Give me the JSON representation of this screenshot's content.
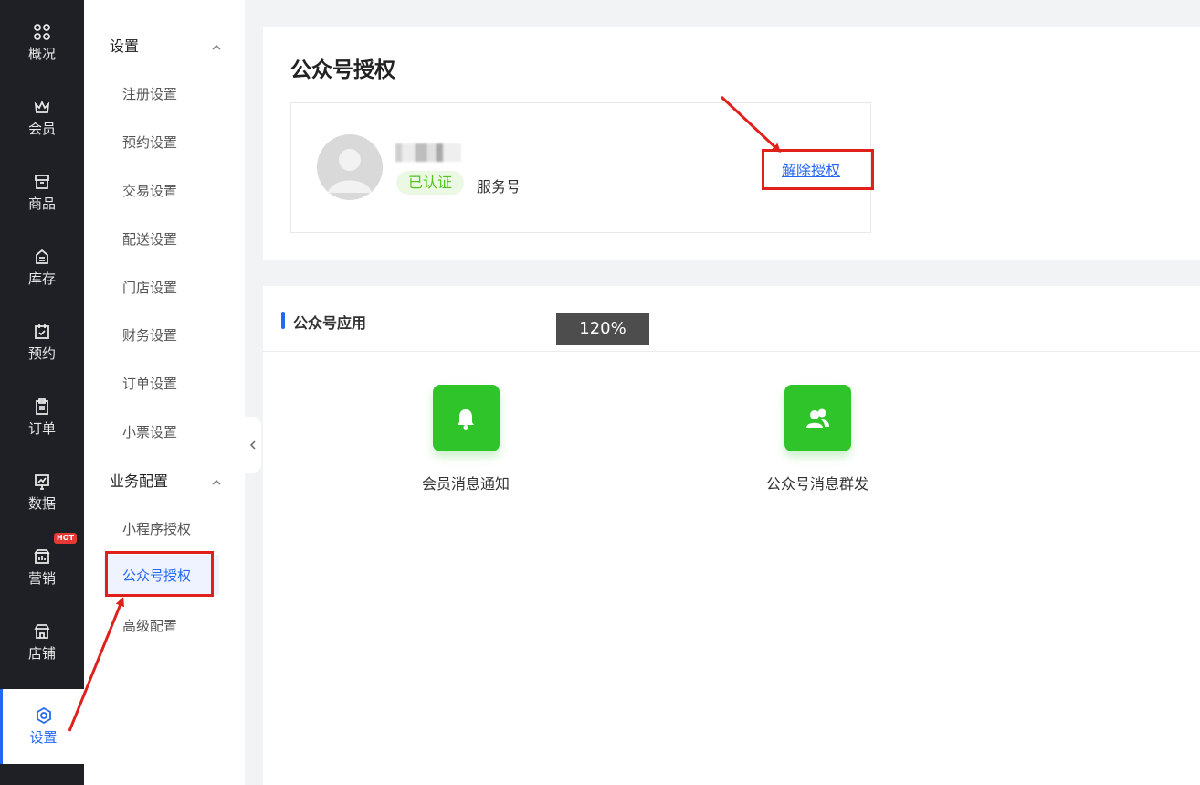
{
  "rail": {
    "items": [
      {
        "label": "概况",
        "icon": "dashboard-icon"
      },
      {
        "label": "会员",
        "icon": "crown-icon"
      },
      {
        "label": "商品",
        "icon": "shop-box-icon"
      },
      {
        "label": "库存",
        "icon": "inventory-icon"
      },
      {
        "label": "预约",
        "icon": "calendar-check-icon"
      },
      {
        "label": "订单",
        "icon": "clipboard-icon"
      },
      {
        "label": "数据",
        "icon": "chart-icon"
      },
      {
        "label": "营销",
        "icon": "marketing-icon",
        "badge": "HOT"
      },
      {
        "label": "店铺",
        "icon": "store-icon"
      },
      {
        "label": "设置",
        "icon": "settings-icon",
        "active": true
      }
    ]
  },
  "submenu": {
    "groups": [
      {
        "title": "设置",
        "items": [
          "注册设置",
          "预约设置",
          "交易设置",
          "配送设置",
          "门店设置",
          "财务设置",
          "订单设置",
          "小票设置"
        ]
      },
      {
        "title": "业务配置",
        "items": [
          "小程序授权",
          "公众号授权",
          "高级配置"
        ]
      }
    ],
    "active_item": "公众号授权"
  },
  "main": {
    "title": "公众号授权",
    "account": {
      "status_badge": "已认证",
      "type": "服务号",
      "revoke_label": "解除授权"
    },
    "apps_section": {
      "title": "公众号应用",
      "apps": [
        {
          "label": "会员消息通知",
          "icon": "bell-icon"
        },
        {
          "label": "公众号消息群发",
          "icon": "users-icon"
        }
      ]
    },
    "zoom_indicator": "120%"
  },
  "colors": {
    "accent": "#2468f2",
    "success": "#52c41a",
    "app_tile": "#2fc52a",
    "rail_bg": "#1f2025",
    "annotation": "#e0201b"
  }
}
